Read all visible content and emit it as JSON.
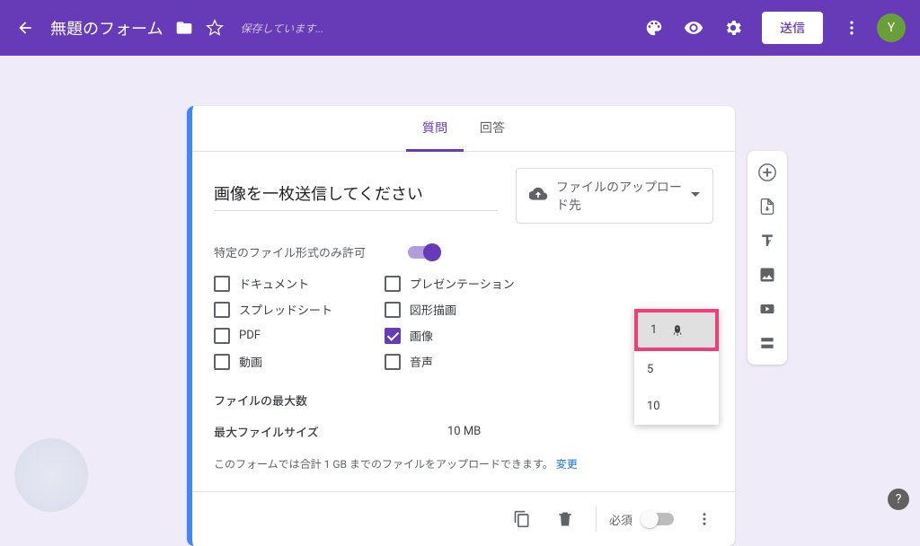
{
  "header": {
    "title": "無題のフォーム",
    "saving": "保存しています...",
    "send": "送信",
    "avatar_initial": "Y"
  },
  "tabs": {
    "questions": "質問",
    "responses": "回答"
  },
  "question": {
    "title": "画像を一枚送信してください",
    "type_label": "ファイルのアップロード先"
  },
  "options": {
    "allow_specific": "特定のファイル形式のみ許可",
    "filetypes": {
      "document": "ドキュメント",
      "presentation": "プレゼンテーション",
      "spreadsheet": "スプレッドシート",
      "drawing": "図形描画",
      "pdf": "PDF",
      "image": "画像",
      "video": "動画",
      "audio": "音声"
    },
    "filetypes_checked": {
      "image": true
    },
    "max_files_label": "ファイルの最大数",
    "max_size_label": "最大ファイルサイズ",
    "max_size_value": "10 MB",
    "note_text": "このフォームでは合計 1 GB までのファイルをアップロードできます。",
    "note_link": "変更"
  },
  "maxfiles_dropdown": {
    "opt1": "1",
    "opt5": "5",
    "opt10": "10"
  },
  "footer": {
    "required": "必須"
  }
}
